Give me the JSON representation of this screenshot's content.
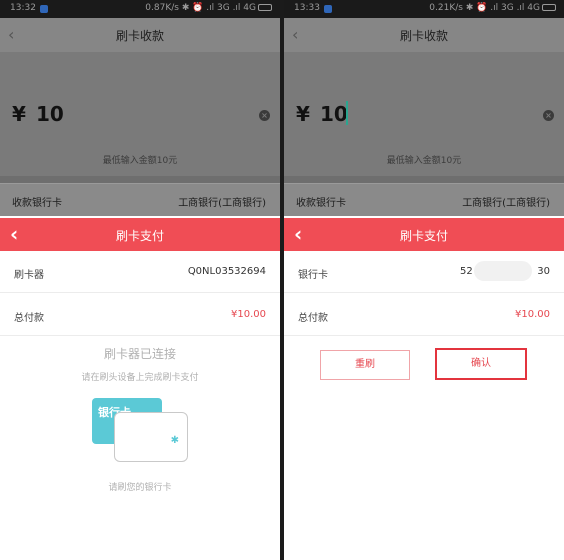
{
  "left": {
    "status": {
      "time": "13:32",
      "right_text": "0.87K/s ✱ ⏰ .ıl 3G .ıl 4G"
    },
    "header": {
      "back_glyph": "‹",
      "title": "刷卡收款"
    },
    "amount": {
      "currency": "¥",
      "value": "10",
      "hint": "最低输入金额10元"
    },
    "bank": {
      "label": "收款银行卡",
      "value": "工商银行(工商银行)"
    },
    "sheet": {
      "back_glyph": "‹",
      "title": "刷卡支付",
      "rows": [
        {
          "label": "刷卡器",
          "value": "Q0NL03532694"
        },
        {
          "label": "总付款",
          "value": "¥10.00"
        }
      ],
      "connected_title": "刷卡器已连接",
      "connected_sub": "请在刷头设备上完成刷卡支付",
      "card_label": "银行卡",
      "bluetooth_icon": "✱",
      "swipe_hint": "请刷您的银行卡"
    }
  },
  "right": {
    "status": {
      "time": "13:33",
      "right_text": "0.21K/s ✱ ⏰ .ıl 3G .ıl 4G"
    },
    "header": {
      "back_glyph": "‹",
      "title": "刷卡收款"
    },
    "amount": {
      "currency": "¥",
      "value": "10",
      "hint": "最低输入金额10元"
    },
    "bank": {
      "label": "收款银行卡",
      "value": "工商银行(工商银行)"
    },
    "sheet": {
      "back_glyph": "‹",
      "title": "刷卡支付",
      "card_row": {
        "label": "银行卡",
        "num_start": "52",
        "num_end": "30"
      },
      "total_row": {
        "label": "总付款",
        "value": "¥10.00"
      },
      "reset_label": "重刷",
      "confirm_label": "确认"
    }
  },
  "colors": {
    "accent_red": "#f04d55",
    "price_red": "#e6474f",
    "card_cyan": "#5bc9d6",
    "caret_green": "#2ba58f"
  }
}
